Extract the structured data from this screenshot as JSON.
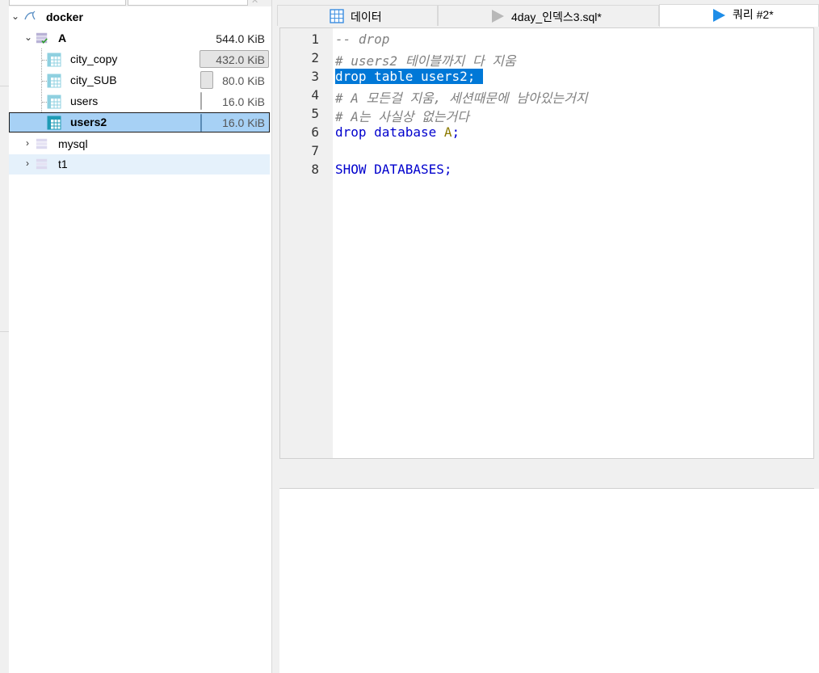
{
  "tree": {
    "connection": {
      "label": "docker",
      "icon": "mysql-dolphin-icon"
    },
    "database": {
      "label": "A",
      "size": "544.0 KiB"
    },
    "tables": [
      {
        "label": "city_copy",
        "size": "432.0 KiB",
        "size_fraction": 0.79
      },
      {
        "label": "city_SUB",
        "size": "80.0 KiB",
        "size_fraction": 0.15
      },
      {
        "label": "users",
        "size": "16.0 KiB",
        "size_fraction": 0.03
      },
      {
        "label": "users2",
        "size": "16.0 KiB",
        "size_fraction": 0.03
      }
    ],
    "selected_table": "users2",
    "other_databases": [
      {
        "label": "mysql"
      },
      {
        "label": "t1"
      }
    ]
  },
  "tabs": [
    {
      "label": "데이터",
      "icon": "grid-icon"
    },
    {
      "label": "4day_인덱스3.sql*",
      "icon": "play-icon-grey"
    },
    {
      "label": "쿼리 #2*",
      "icon": "play-icon-blue",
      "active": true
    }
  ],
  "editor": {
    "line_numbers": [
      "1",
      "2",
      "3",
      "4",
      "5",
      "6",
      "7",
      "8"
    ],
    "lines": [
      {
        "parts": [
          {
            "t": "-- drop",
            "c": "cm"
          }
        ]
      },
      {
        "parts": [
          {
            "t": "# users2 테이블까지 다 지움",
            "c": "cm"
          }
        ]
      },
      {
        "parts": [
          {
            "t": "drop table users2;",
            "c": "kw hl"
          },
          {
            "t": " ",
            "c": "hl"
          }
        ]
      },
      {
        "parts": [
          {
            "t": "# A 모든걸 지움, 세션때문에 남아있는거지",
            "c": "cm"
          }
        ]
      },
      {
        "parts": [
          {
            "t": "# A는 사실상 없는거다",
            "c": "cm"
          }
        ]
      },
      {
        "parts": [
          {
            "t": "drop database ",
            "c": "kw"
          },
          {
            "t": "A",
            "c": "id"
          },
          {
            "t": ";",
            "c": "kw"
          }
        ]
      },
      {
        "parts": []
      },
      {
        "parts": [
          {
            "t": "SHOW DATABASES;",
            "c": "kw"
          }
        ]
      }
    ]
  },
  "colors": {
    "selection": "#0078d7",
    "keyword": "#0000cd",
    "comment": "#808080",
    "tree_selected": "#a7d1f5",
    "tree_hover": "#e5f1fb"
  }
}
